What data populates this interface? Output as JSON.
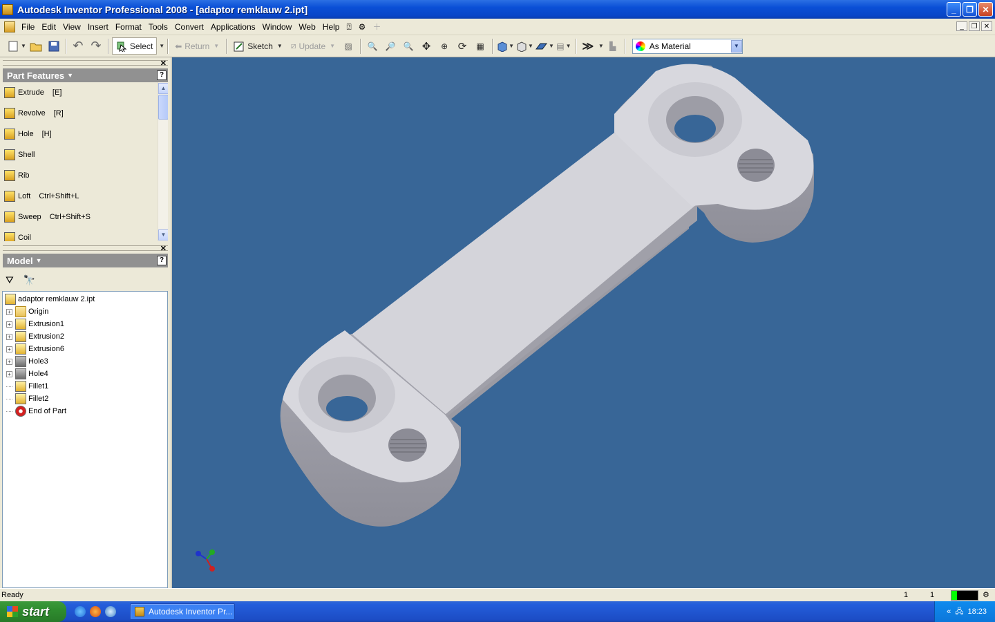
{
  "window": {
    "title": "Autodesk Inventor Professional 2008 - [adaptor remklauw 2.ipt]"
  },
  "menu": [
    "File",
    "Edit",
    "View",
    "Insert",
    "Format",
    "Tools",
    "Convert",
    "Applications",
    "Window",
    "Web",
    "Help"
  ],
  "toolbar": {
    "select_label": "Select",
    "return_label": "Return",
    "sketch_label": "Sketch",
    "update_label": "Update",
    "material_value": "As Material"
  },
  "part_features": {
    "title": "Part Features",
    "items": [
      {
        "label": "Extrude",
        "key": "[E]"
      },
      {
        "label": "Revolve",
        "key": "[R]"
      },
      {
        "label": "Hole",
        "key": "[H]"
      },
      {
        "label": "Shell",
        "key": ""
      },
      {
        "label": "Rib",
        "key": ""
      },
      {
        "label": "Loft",
        "key": "Ctrl+Shift+L"
      },
      {
        "label": "Sweep",
        "key": "Ctrl+Shift+S"
      },
      {
        "label": "Coil",
        "key": ""
      }
    ]
  },
  "model": {
    "title": "Model",
    "root": "adaptor remklauw 2.ipt",
    "nodes": [
      {
        "label": "Origin",
        "icon": "folder-icon",
        "expandable": true
      },
      {
        "label": "Extrusion1",
        "icon": "extrusion-icon",
        "expandable": true
      },
      {
        "label": "Extrusion2",
        "icon": "extrusion-icon",
        "expandable": true
      },
      {
        "label": "Extrusion6",
        "icon": "extrusion-icon",
        "expandable": true
      },
      {
        "label": "Hole3",
        "icon": "hole-icon",
        "expandable": true
      },
      {
        "label": "Hole4",
        "icon": "hole-icon",
        "expandable": true
      },
      {
        "label": "Fillet1",
        "icon": "fillet-icon",
        "expandable": false
      },
      {
        "label": "Fillet2",
        "icon": "fillet-icon",
        "expandable": false
      },
      {
        "label": "End of Part",
        "icon": "end-of-part-icon",
        "expandable": false
      }
    ]
  },
  "status": {
    "text": "Ready",
    "val1": "1",
    "val2": "1"
  },
  "taskbar": {
    "start": "start",
    "task": "Autodesk Inventor Pr...",
    "clock": "18:23"
  },
  "colors": {
    "viewport_bg": "#386697",
    "part": "#cfcfd6"
  }
}
